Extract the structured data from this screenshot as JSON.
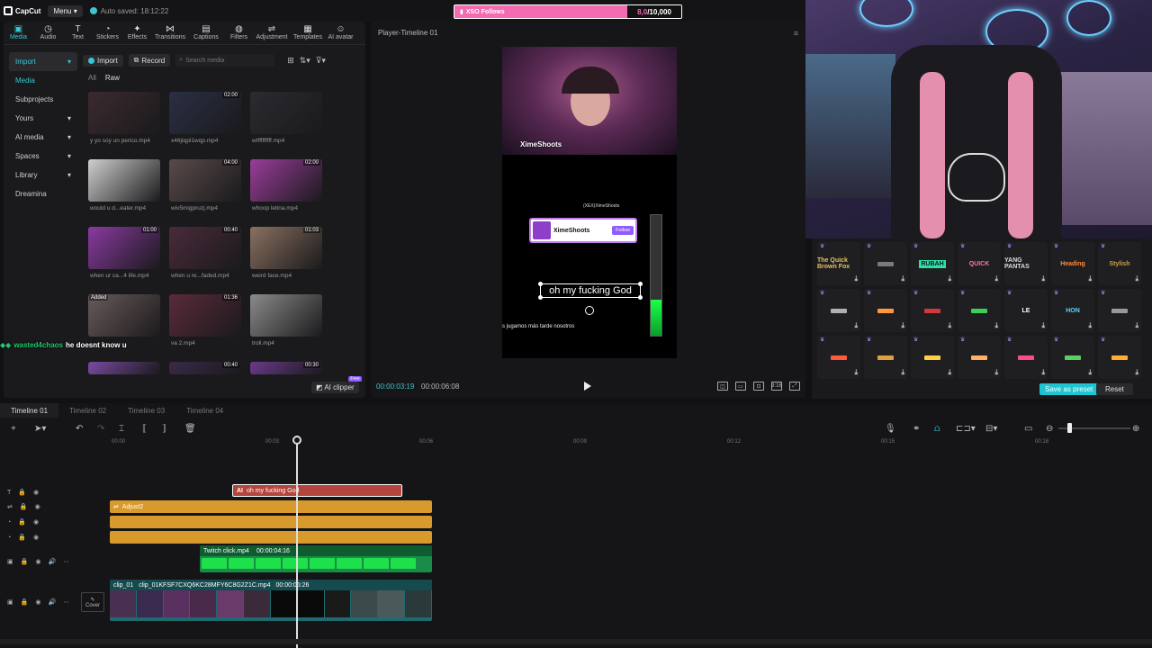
{
  "app": {
    "logo_text": "CapCut",
    "menu_label": "Menu",
    "autosave_text": "Auto saved: 18:12:22"
  },
  "follow_overlay": {
    "label": "XSO Follows",
    "progress_text": "8,0",
    "goal_text": "/10,000",
    "fill_fraction": 0.8
  },
  "tool_tabs": [
    {
      "label": "Media",
      "icon": "media-icon"
    },
    {
      "label": "Audio",
      "icon": "audio-icon"
    },
    {
      "label": "Text",
      "icon": "text-icon"
    },
    {
      "label": "Stickers",
      "icon": "stickers-icon"
    },
    {
      "label": "Effects",
      "icon": "effects-icon"
    },
    {
      "label": "Transitions",
      "icon": "transitions-icon"
    },
    {
      "label": "Captions",
      "icon": "captions-icon"
    },
    {
      "label": "Filters",
      "icon": "filters-icon"
    },
    {
      "label": "Adjustment",
      "icon": "adjustment-icon"
    },
    {
      "label": "Templates",
      "icon": "templates-icon"
    },
    {
      "label": "AI avatar",
      "icon": "ai-avatar-icon"
    }
  ],
  "sidebar": [
    {
      "label": "Import",
      "expandable": true
    },
    {
      "label": "Media",
      "expandable": false
    },
    {
      "label": "Subprojects",
      "expandable": false
    },
    {
      "label": "Yours",
      "expandable": true
    },
    {
      "label": "AI media",
      "expandable": true
    },
    {
      "label": "Spaces",
      "expandable": true
    },
    {
      "label": "Library",
      "expandable": true
    },
    {
      "label": "Dreamina",
      "expandable": false
    }
  ],
  "media_toolbar": {
    "import_label": "Import",
    "record_label": "Record",
    "search_placeholder": "Search media"
  },
  "filters": {
    "all": "All",
    "raw": "Raw"
  },
  "media_items": [
    {
      "name": "y yo soy un perico.mp4",
      "duration": "",
      "added": ""
    },
    {
      "name": "x46jtqpl1wqp.mp4",
      "duration": "02:00",
      "added": ""
    },
    {
      "name": "wtfffffffff.mp4",
      "duration": "",
      "added": ""
    },
    {
      "name": "would u d...eater.mp4",
      "duration": "",
      "added": ""
    },
    {
      "name": "wiv5migpruzj.mp4",
      "duration": "04:00",
      "added": ""
    },
    {
      "name": "whoop letina.mp4",
      "duration": "02:00",
      "added": ""
    },
    {
      "name": "when ur ca...4 life.mp4",
      "duration": "01:00",
      "added": ""
    },
    {
      "name": "when u re...faded.mp4",
      "duration": "00:40",
      "added": ""
    },
    {
      "name": "weird face.mp4",
      "duration": "01:03",
      "added": ""
    },
    {
      "name": "",
      "duration": "",
      "added": "Added"
    },
    {
      "name": "va 2.mp4",
      "duration": "01:36",
      "added": ""
    },
    {
      "name": "troll.mp4",
      "duration": "",
      "added": ""
    },
    {
      "name": "",
      "duration": "",
      "added": ""
    },
    {
      "name": "",
      "duration": "00:40",
      "added": ""
    },
    {
      "name": "",
      "duration": "00:30",
      "added": ""
    }
  ],
  "ai_clipper": {
    "label": "AI clipper",
    "badge": "Free"
  },
  "chat": {
    "user": "wasted4chaos",
    "message": "he doesnt know u"
  },
  "player": {
    "title": "Player-Timeline 01",
    "current_time": "00:00:03:19",
    "total_time": "00:00:06:08",
    "cam_name": "XimeShoots",
    "alert_name": "XimeShoots",
    "alert_follow": "Follow",
    "small_overlay": "(XEX)XimeShoots",
    "subtitle": "oh my fucking God",
    "bottom_text": "s jugamos más tarde nosotros",
    "meter_fraction": 0.3,
    "ratio_label": "9:16"
  },
  "presets": {
    "items": [
      "The Quick Brown Fox",
      "",
      "RUBAH",
      "QUICK",
      "YANG PANTAS",
      "Heading",
      "Stylish",
      "",
      "",
      "",
      "",
      "LE",
      "HON",
      "",
      "",
      "",
      "",
      "",
      "",
      "",
      ""
    ],
    "save_label": "Save as preset",
    "reset_label": "Reset"
  },
  "timeline": {
    "tabs": [
      "Timeline 01",
      "Timeline 02",
      "Timeline 03",
      "Timeline 04"
    ],
    "ruler": [
      "00:00",
      "00:03",
      "00:06",
      "00:09",
      "00:12",
      "00:15",
      "00:18"
    ],
    "text_clip": "oh my fucking God",
    "adjust_clip": "Adjust2",
    "green_clip": "Twitch click.mp4",
    "green_clip_dur": "00:00:04:16",
    "main_clip_1": "clip_01",
    "main_clip_2": "clip_01KFSF7CXQ6KC28MFY6C8G2Z1C.mp4",
    "main_clip_dur": "00:00:05:26",
    "cover_label": "Cover"
  },
  "colors": {
    "accent": "#35c8d4",
    "text_clip": "#b3453c",
    "adjust_clip": "#d89a2c",
    "green_clip": "#1a8c4a",
    "main_clip": "#1f6a6f"
  }
}
